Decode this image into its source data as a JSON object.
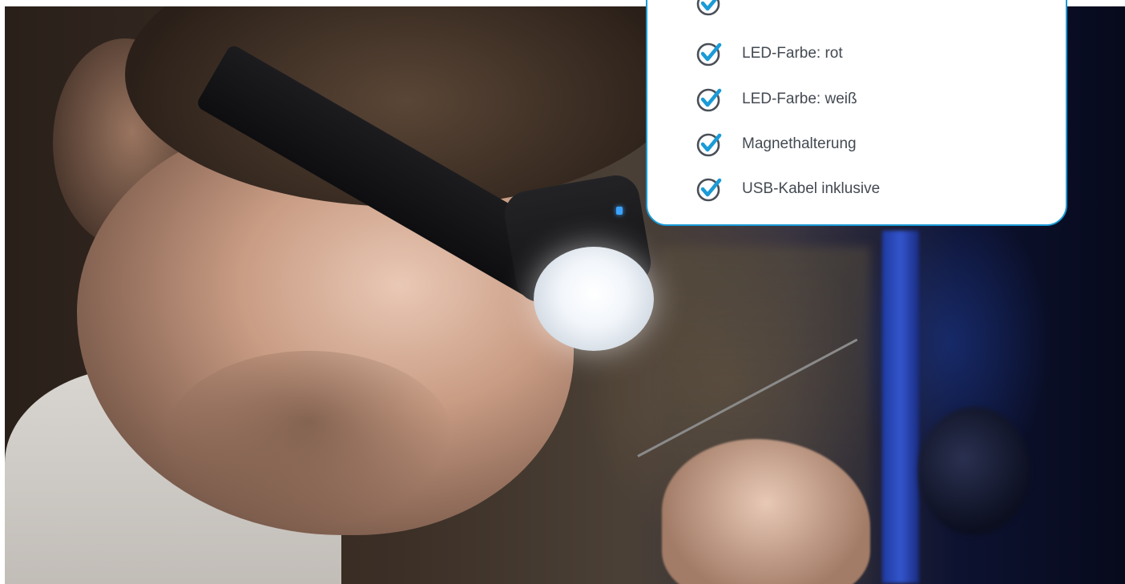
{
  "colors": {
    "accent": "#1a9bd7",
    "text": "#444a52",
    "card_background": "#ffffff"
  },
  "feature_card": {
    "items": [
      {
        "label": "",
        "icon": "check-circle-icon"
      },
      {
        "label": "LED-Farbe: rot",
        "icon": "check-circle-icon"
      },
      {
        "label": "LED-Farbe: weiß",
        "icon": "check-circle-icon"
      },
      {
        "label": "Magnethalterung",
        "icon": "check-circle-icon"
      },
      {
        "label": "USB-Kabel inklusive",
        "icon": "check-circle-icon"
      }
    ]
  },
  "photo": {
    "subject": "man-wearing-headlamp"
  }
}
